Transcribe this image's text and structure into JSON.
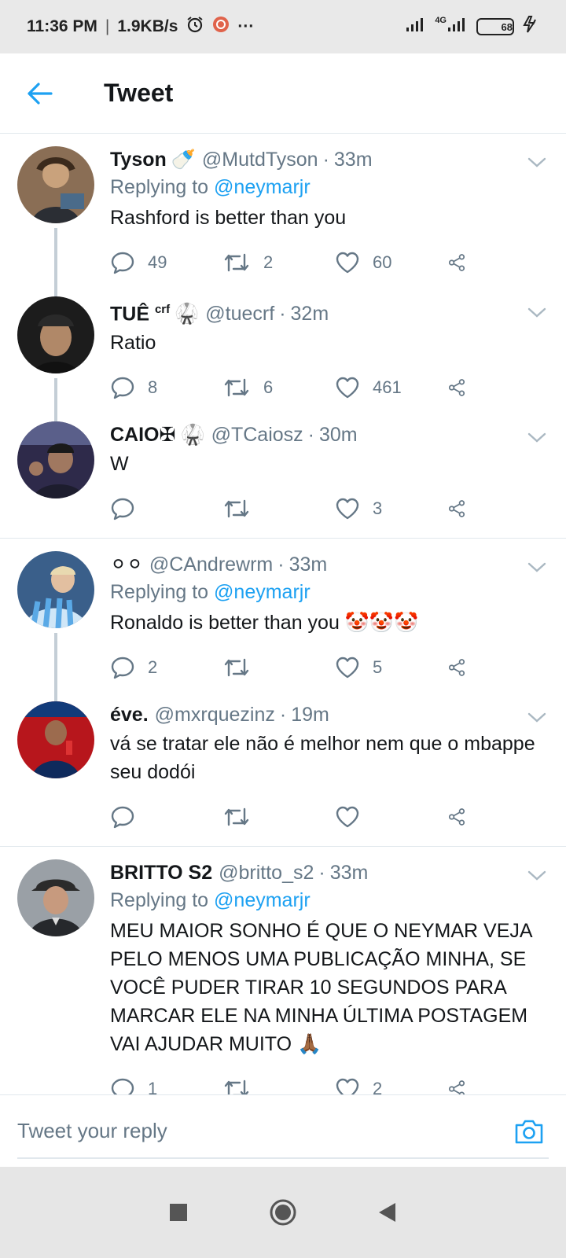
{
  "status_bar": {
    "time": "11:36 PM",
    "separator": "|",
    "speed": "1.9KB/s",
    "more": "···",
    "network": "4G",
    "battery": "68"
  },
  "header": {
    "title": "Tweet"
  },
  "tweets": [
    {
      "name": "Tyson",
      "name_extra": "🍼",
      "handle": "@MutdTyson",
      "time": "33m",
      "replying_label": "Replying to",
      "replying_to": "@neymarjr",
      "text": "Rashford is better than you",
      "replies": "49",
      "retweets": "2",
      "likes": "60"
    },
    {
      "name": "TUÊ",
      "name_sup": "crf",
      "name_extra": "🥋",
      "handle": "@tuecrf",
      "time": "32m",
      "text": "Ratio",
      "replies": "8",
      "retweets": "6",
      "likes": "461"
    },
    {
      "name": "CAIO✠",
      "name_extra": "🥋",
      "handle": "@TCaiosz",
      "time": "30m",
      "text": "W",
      "replies": "",
      "retweets": "",
      "likes": "3"
    },
    {
      "name": "",
      "name_extra": "⚪⚪",
      "handle": "@CAndrewrm",
      "time": "33m",
      "replying_label": "Replying to",
      "replying_to": "@neymarjr",
      "text": "Ronaldo is better than you 🤡🤡🤡",
      "replies": "2",
      "retweets": "",
      "likes": "5"
    },
    {
      "name": "éve.",
      "handle": "@mxrquezinz",
      "time": "19m",
      "text": "vá se tratar ele não é melhor nem que o mbappe seu dodói",
      "replies": "",
      "retweets": "",
      "likes": ""
    },
    {
      "name": "BRITTO S2",
      "handle": "@britto_s2",
      "time": "33m",
      "replying_label": "Replying to",
      "replying_to": "@neymarjr",
      "text": "MEU MAIOR SONHO É QUE O NEYMAR VEJA PELO MENOS UMA PUBLICAÇÃO MINHA, SE VOCÊ PUDER TIRAR 10 SEGUNDOS PARA MARCAR ELE NA MINHA ÚLTIMA POSTAGEM VAI AJUDAR MUITO 🙏🏾",
      "replies": "1",
      "retweets": "",
      "likes": "2"
    }
  ],
  "reply_bar": {
    "placeholder": "Tweet your reply"
  },
  "colors": {
    "accent": "#1da1f2",
    "muted": "#657786",
    "text": "#14171a",
    "divider": "#e1e8ed"
  }
}
